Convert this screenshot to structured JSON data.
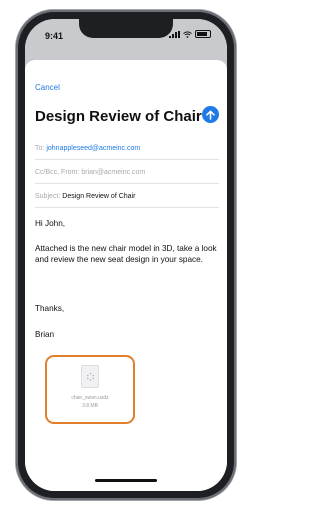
{
  "status_bar": {
    "time": "9:41"
  },
  "compose": {
    "cancel_label": "Cancel",
    "title": "Design Review of Chair",
    "to_label": "To:",
    "to_value": "johnappleseed@acmeinc.com",
    "cc_label": "Cc/Bcc, From:",
    "from_value": "brian@acmeinc.com",
    "subject_label": "Subject:",
    "subject_value": "Design Review of Chair",
    "greeting": "Hi John,",
    "body": "Attached is the new chair model in 3D, take a look and review the new seat design in your space.",
    "closing": "Thanks,",
    "signature": "Brian"
  },
  "attachment": {
    "filename": "chair_swan.usdz",
    "size": "3.8 MB"
  },
  "colors": {
    "accent": "#1f7ae6",
    "highlight": "#e07f2c"
  }
}
